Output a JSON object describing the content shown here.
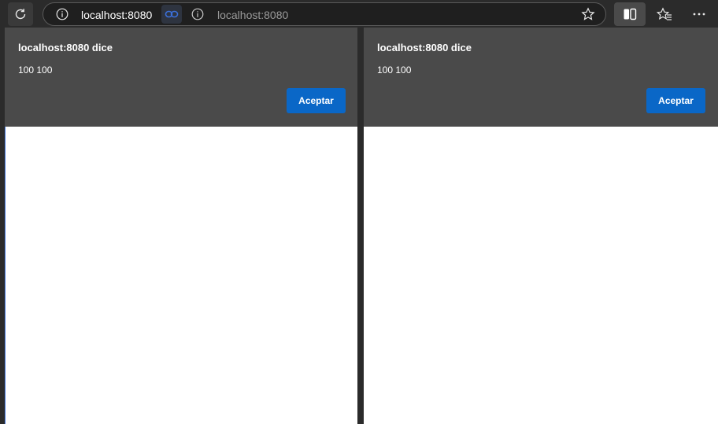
{
  "toolbar": {
    "reload_icon": "reload-icon",
    "address_bar": {
      "active_url": "localhost:8080",
      "inactive_url": "localhost:8080"
    },
    "icons": [
      "info-icon",
      "link-icon",
      "star-icon",
      "split-screen-icon",
      "favorites-icon",
      "more-icon"
    ]
  },
  "panes": [
    {
      "dialog": {
        "title": "localhost:8080 dice",
        "message": "100 100",
        "accept_label": "Aceptar"
      }
    },
    {
      "dialog": {
        "title": "localhost:8080 dice",
        "message": "100 100",
        "accept_label": "Aceptar"
      }
    }
  ],
  "colors": {
    "toolbar_bg": "#2b2b2b",
    "dialog_bg": "#4a4a4a",
    "accent": "#0a67c7"
  }
}
